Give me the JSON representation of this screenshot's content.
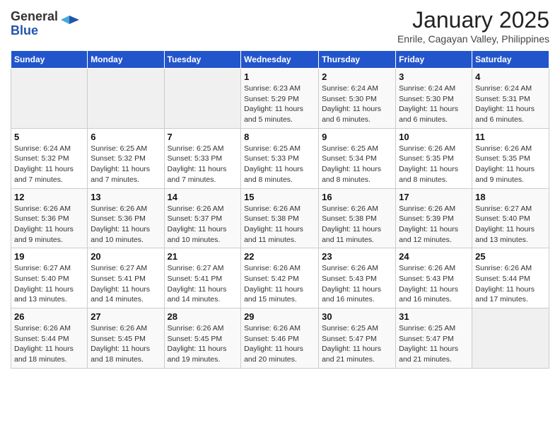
{
  "header": {
    "logo_general": "General",
    "logo_blue": "Blue",
    "month_title": "January 2025",
    "location": "Enrile, Cagayan Valley, Philippines"
  },
  "weekdays": [
    "Sunday",
    "Monday",
    "Tuesday",
    "Wednesday",
    "Thursday",
    "Friday",
    "Saturday"
  ],
  "weeks": [
    [
      {
        "day": "",
        "info": ""
      },
      {
        "day": "",
        "info": ""
      },
      {
        "day": "",
        "info": ""
      },
      {
        "day": "1",
        "info": "Sunrise: 6:23 AM\nSunset: 5:29 PM\nDaylight: 11 hours and 5 minutes."
      },
      {
        "day": "2",
        "info": "Sunrise: 6:24 AM\nSunset: 5:30 PM\nDaylight: 11 hours and 6 minutes."
      },
      {
        "day": "3",
        "info": "Sunrise: 6:24 AM\nSunset: 5:30 PM\nDaylight: 11 hours and 6 minutes."
      },
      {
        "day": "4",
        "info": "Sunrise: 6:24 AM\nSunset: 5:31 PM\nDaylight: 11 hours and 6 minutes."
      }
    ],
    [
      {
        "day": "5",
        "info": "Sunrise: 6:24 AM\nSunset: 5:32 PM\nDaylight: 11 hours and 7 minutes."
      },
      {
        "day": "6",
        "info": "Sunrise: 6:25 AM\nSunset: 5:32 PM\nDaylight: 11 hours and 7 minutes."
      },
      {
        "day": "7",
        "info": "Sunrise: 6:25 AM\nSunset: 5:33 PM\nDaylight: 11 hours and 7 minutes."
      },
      {
        "day": "8",
        "info": "Sunrise: 6:25 AM\nSunset: 5:33 PM\nDaylight: 11 hours and 8 minutes."
      },
      {
        "day": "9",
        "info": "Sunrise: 6:25 AM\nSunset: 5:34 PM\nDaylight: 11 hours and 8 minutes."
      },
      {
        "day": "10",
        "info": "Sunrise: 6:26 AM\nSunset: 5:35 PM\nDaylight: 11 hours and 8 minutes."
      },
      {
        "day": "11",
        "info": "Sunrise: 6:26 AM\nSunset: 5:35 PM\nDaylight: 11 hours and 9 minutes."
      }
    ],
    [
      {
        "day": "12",
        "info": "Sunrise: 6:26 AM\nSunset: 5:36 PM\nDaylight: 11 hours and 9 minutes."
      },
      {
        "day": "13",
        "info": "Sunrise: 6:26 AM\nSunset: 5:36 PM\nDaylight: 11 hours and 10 minutes."
      },
      {
        "day": "14",
        "info": "Sunrise: 6:26 AM\nSunset: 5:37 PM\nDaylight: 11 hours and 10 minutes."
      },
      {
        "day": "15",
        "info": "Sunrise: 6:26 AM\nSunset: 5:38 PM\nDaylight: 11 hours and 11 minutes."
      },
      {
        "day": "16",
        "info": "Sunrise: 6:26 AM\nSunset: 5:38 PM\nDaylight: 11 hours and 11 minutes."
      },
      {
        "day": "17",
        "info": "Sunrise: 6:26 AM\nSunset: 5:39 PM\nDaylight: 11 hours and 12 minutes."
      },
      {
        "day": "18",
        "info": "Sunrise: 6:27 AM\nSunset: 5:40 PM\nDaylight: 11 hours and 13 minutes."
      }
    ],
    [
      {
        "day": "19",
        "info": "Sunrise: 6:27 AM\nSunset: 5:40 PM\nDaylight: 11 hours and 13 minutes."
      },
      {
        "day": "20",
        "info": "Sunrise: 6:27 AM\nSunset: 5:41 PM\nDaylight: 11 hours and 14 minutes."
      },
      {
        "day": "21",
        "info": "Sunrise: 6:27 AM\nSunset: 5:41 PM\nDaylight: 11 hours and 14 minutes."
      },
      {
        "day": "22",
        "info": "Sunrise: 6:26 AM\nSunset: 5:42 PM\nDaylight: 11 hours and 15 minutes."
      },
      {
        "day": "23",
        "info": "Sunrise: 6:26 AM\nSunset: 5:43 PM\nDaylight: 11 hours and 16 minutes."
      },
      {
        "day": "24",
        "info": "Sunrise: 6:26 AM\nSunset: 5:43 PM\nDaylight: 11 hours and 16 minutes."
      },
      {
        "day": "25",
        "info": "Sunrise: 6:26 AM\nSunset: 5:44 PM\nDaylight: 11 hours and 17 minutes."
      }
    ],
    [
      {
        "day": "26",
        "info": "Sunrise: 6:26 AM\nSunset: 5:44 PM\nDaylight: 11 hours and 18 minutes."
      },
      {
        "day": "27",
        "info": "Sunrise: 6:26 AM\nSunset: 5:45 PM\nDaylight: 11 hours and 18 minutes."
      },
      {
        "day": "28",
        "info": "Sunrise: 6:26 AM\nSunset: 5:45 PM\nDaylight: 11 hours and 19 minutes."
      },
      {
        "day": "29",
        "info": "Sunrise: 6:26 AM\nSunset: 5:46 PM\nDaylight: 11 hours and 20 minutes."
      },
      {
        "day": "30",
        "info": "Sunrise: 6:25 AM\nSunset: 5:47 PM\nDaylight: 11 hours and 21 minutes."
      },
      {
        "day": "31",
        "info": "Sunrise: 6:25 AM\nSunset: 5:47 PM\nDaylight: 11 hours and 21 minutes."
      },
      {
        "day": "",
        "info": ""
      }
    ]
  ]
}
